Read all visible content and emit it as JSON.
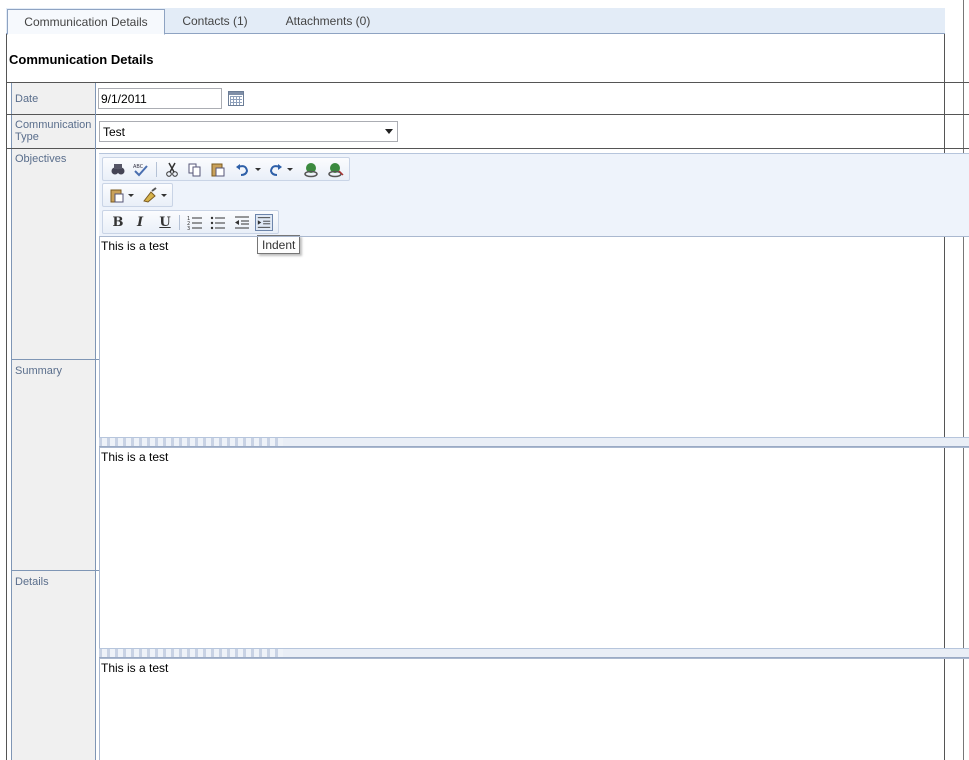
{
  "tabs": [
    {
      "label": "Communication Details",
      "active": true
    },
    {
      "label": "Contacts (1)",
      "active": false
    },
    {
      "label": "Attachments (0)",
      "active": false
    }
  ],
  "panel": {
    "title": "Communication Details"
  },
  "form": {
    "date_label": "Date",
    "date_value": "9/1/2011",
    "comm_type_label": "Communication Type",
    "comm_type_value": "Test",
    "objectives_label": "Objectives",
    "summary_label": "Summary",
    "details_label": "Details"
  },
  "editors": {
    "objectives_text": "This is a test",
    "summary_text": "This is a test",
    "details_text": "This is a test"
  },
  "toolbar": {
    "row1_icons": [
      "find-icon",
      "spellcheck-icon",
      "cut-icon",
      "copy-icon",
      "paste-icon",
      "undo-icon",
      "redo-icon",
      "link-icon",
      "unlink-icon"
    ],
    "row2_icons": [
      "paste-options-icon",
      "format-stripper-icon"
    ],
    "row3": {
      "bold": "B",
      "italic": "I",
      "underline": "U"
    },
    "row3_icons": [
      "ordered-list-icon",
      "unordered-list-icon",
      "outdent-icon",
      "indent-icon"
    ],
    "tooltip": "Indent"
  },
  "colors": {
    "tab_bar": "#e3ecf7",
    "label_text": "#5a6e8c",
    "toolbar_bg": "#eef3fb"
  }
}
